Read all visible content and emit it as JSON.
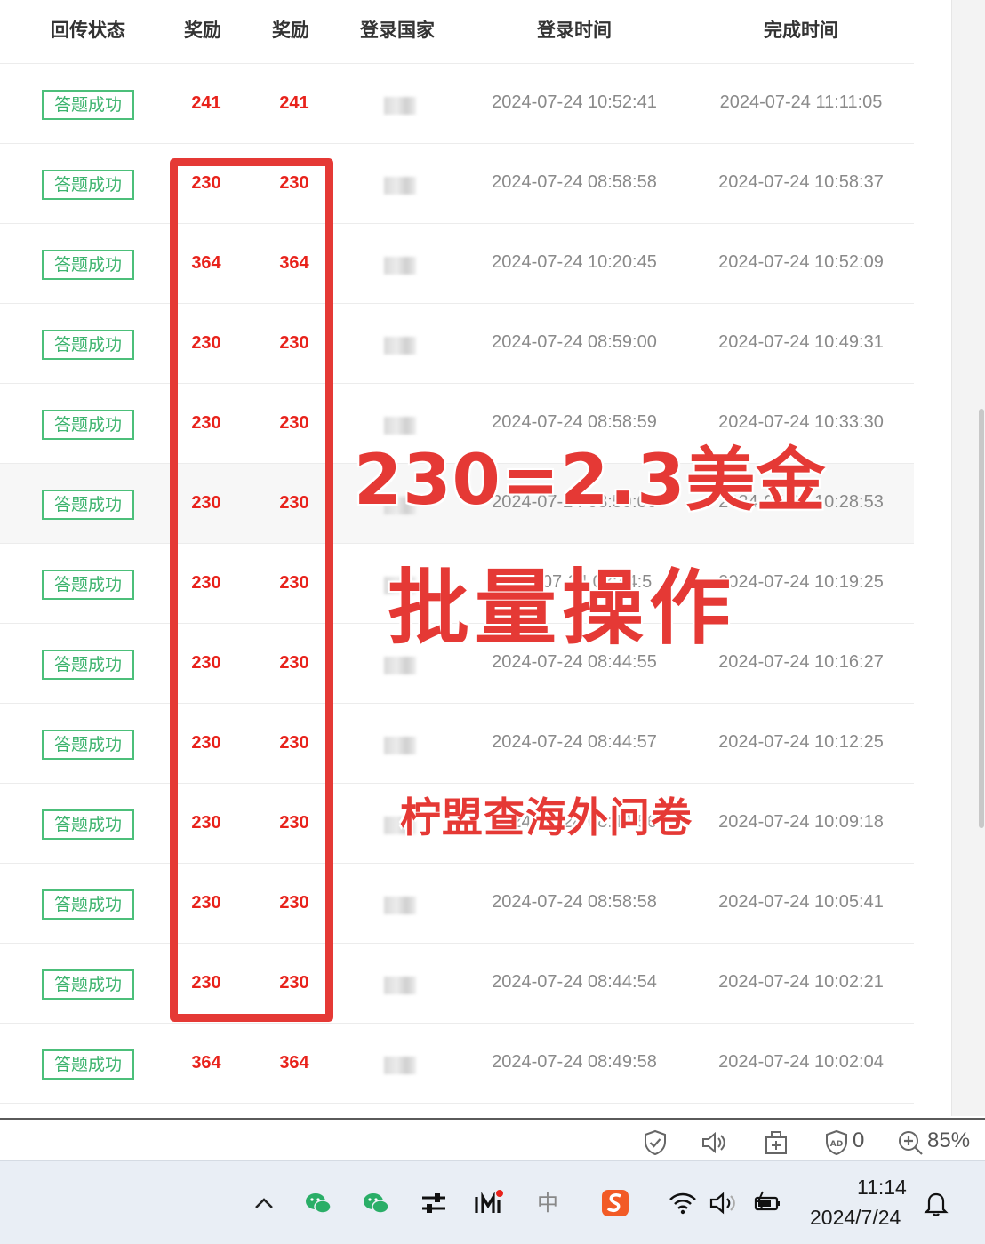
{
  "table": {
    "headers": [
      "回传状态",
      "奖励",
      "奖励",
      "登录国家",
      "登录时间",
      "完成时间"
    ],
    "rows": [
      {
        "status": "答题成功",
        "reward_a": "241",
        "reward_b": "241",
        "login_time": "2024-07-24 10:52:41",
        "finish_time": "2024-07-24 11:11:05"
      },
      {
        "status": "答题成功",
        "reward_a": "230",
        "reward_b": "230",
        "login_time": "2024-07-24 08:58:58",
        "finish_time": "2024-07-24 10:58:37"
      },
      {
        "status": "答题成功",
        "reward_a": "364",
        "reward_b": "364",
        "login_time": "2024-07-24 10:20:45",
        "finish_time": "2024-07-24 10:52:09"
      },
      {
        "status": "答题成功",
        "reward_a": "230",
        "reward_b": "230",
        "login_time": "2024-07-24 08:59:00",
        "finish_time": "2024-07-24 10:49:31"
      },
      {
        "status": "答题成功",
        "reward_a": "230",
        "reward_b": "230",
        "login_time": "2024-07-24 08:58:59",
        "finish_time": "2024-07-24 10:33:30"
      },
      {
        "status": "答题成功",
        "reward_a": "230",
        "reward_b": "230",
        "login_time": "2024-07-24 08:59:00",
        "finish_time": "2024-07-24 10:28:53"
      },
      {
        "status": "答题成功",
        "reward_a": "230",
        "reward_b": "230",
        "login_time": "2024-07-24 08:44:5",
        "finish_time": "2024-07-24 10:19:25"
      },
      {
        "status": "答题成功",
        "reward_a": "230",
        "reward_b": "230",
        "login_time": "2024-07-24 08:44:55",
        "finish_time": "2024-07-24 10:16:27"
      },
      {
        "status": "答题成功",
        "reward_a": "230",
        "reward_b": "230",
        "login_time": "2024-07-24 08:44:57",
        "finish_time": "2024-07-24 10:12:25"
      },
      {
        "status": "答题成功",
        "reward_a": "230",
        "reward_b": "230",
        "login_time": "2024-07-24 08:44:56",
        "finish_time": "2024-07-24 10:09:18"
      },
      {
        "status": "答题成功",
        "reward_a": "230",
        "reward_b": "230",
        "login_time": "2024-07-24 08:58:58",
        "finish_time": "2024-07-24 10:05:41"
      },
      {
        "status": "答题成功",
        "reward_a": "230",
        "reward_b": "230",
        "login_time": "2024-07-24 08:44:54",
        "finish_time": "2024-07-24 10:02:21"
      },
      {
        "status": "答题成功",
        "reward_a": "364",
        "reward_b": "364",
        "login_time": "2024-07-24 08:49:58",
        "finish_time": "2024-07-24 10:02:04"
      }
    ]
  },
  "overlay": {
    "line1": "230=2.3美金",
    "line2": "批量操作",
    "line3": "柠盟查海外问卷"
  },
  "status_bar": {
    "icons": [
      "shield-check-icon",
      "read-aloud-icon",
      "extension-icon",
      "adblock-icon",
      "zoom-icon"
    ],
    "ad_count": "0",
    "zoom": "85%"
  },
  "taskbar": {
    "icons": [
      "chevron-up-icon",
      "wechat-icon",
      "wechat-icon",
      "sliders-icon",
      "imi-icon",
      "ime-zhong-icon",
      "sogou-icon",
      "wifi-icon",
      "volume-icon",
      "battery-icon",
      "notification-bell-icon"
    ],
    "ime_label": "中",
    "time": "11:14",
    "date": "2024/7/24"
  },
  "colors": {
    "reward_red": "#e8221b",
    "status_green": "#3bb36d",
    "highlight_red": "#e53935"
  }
}
